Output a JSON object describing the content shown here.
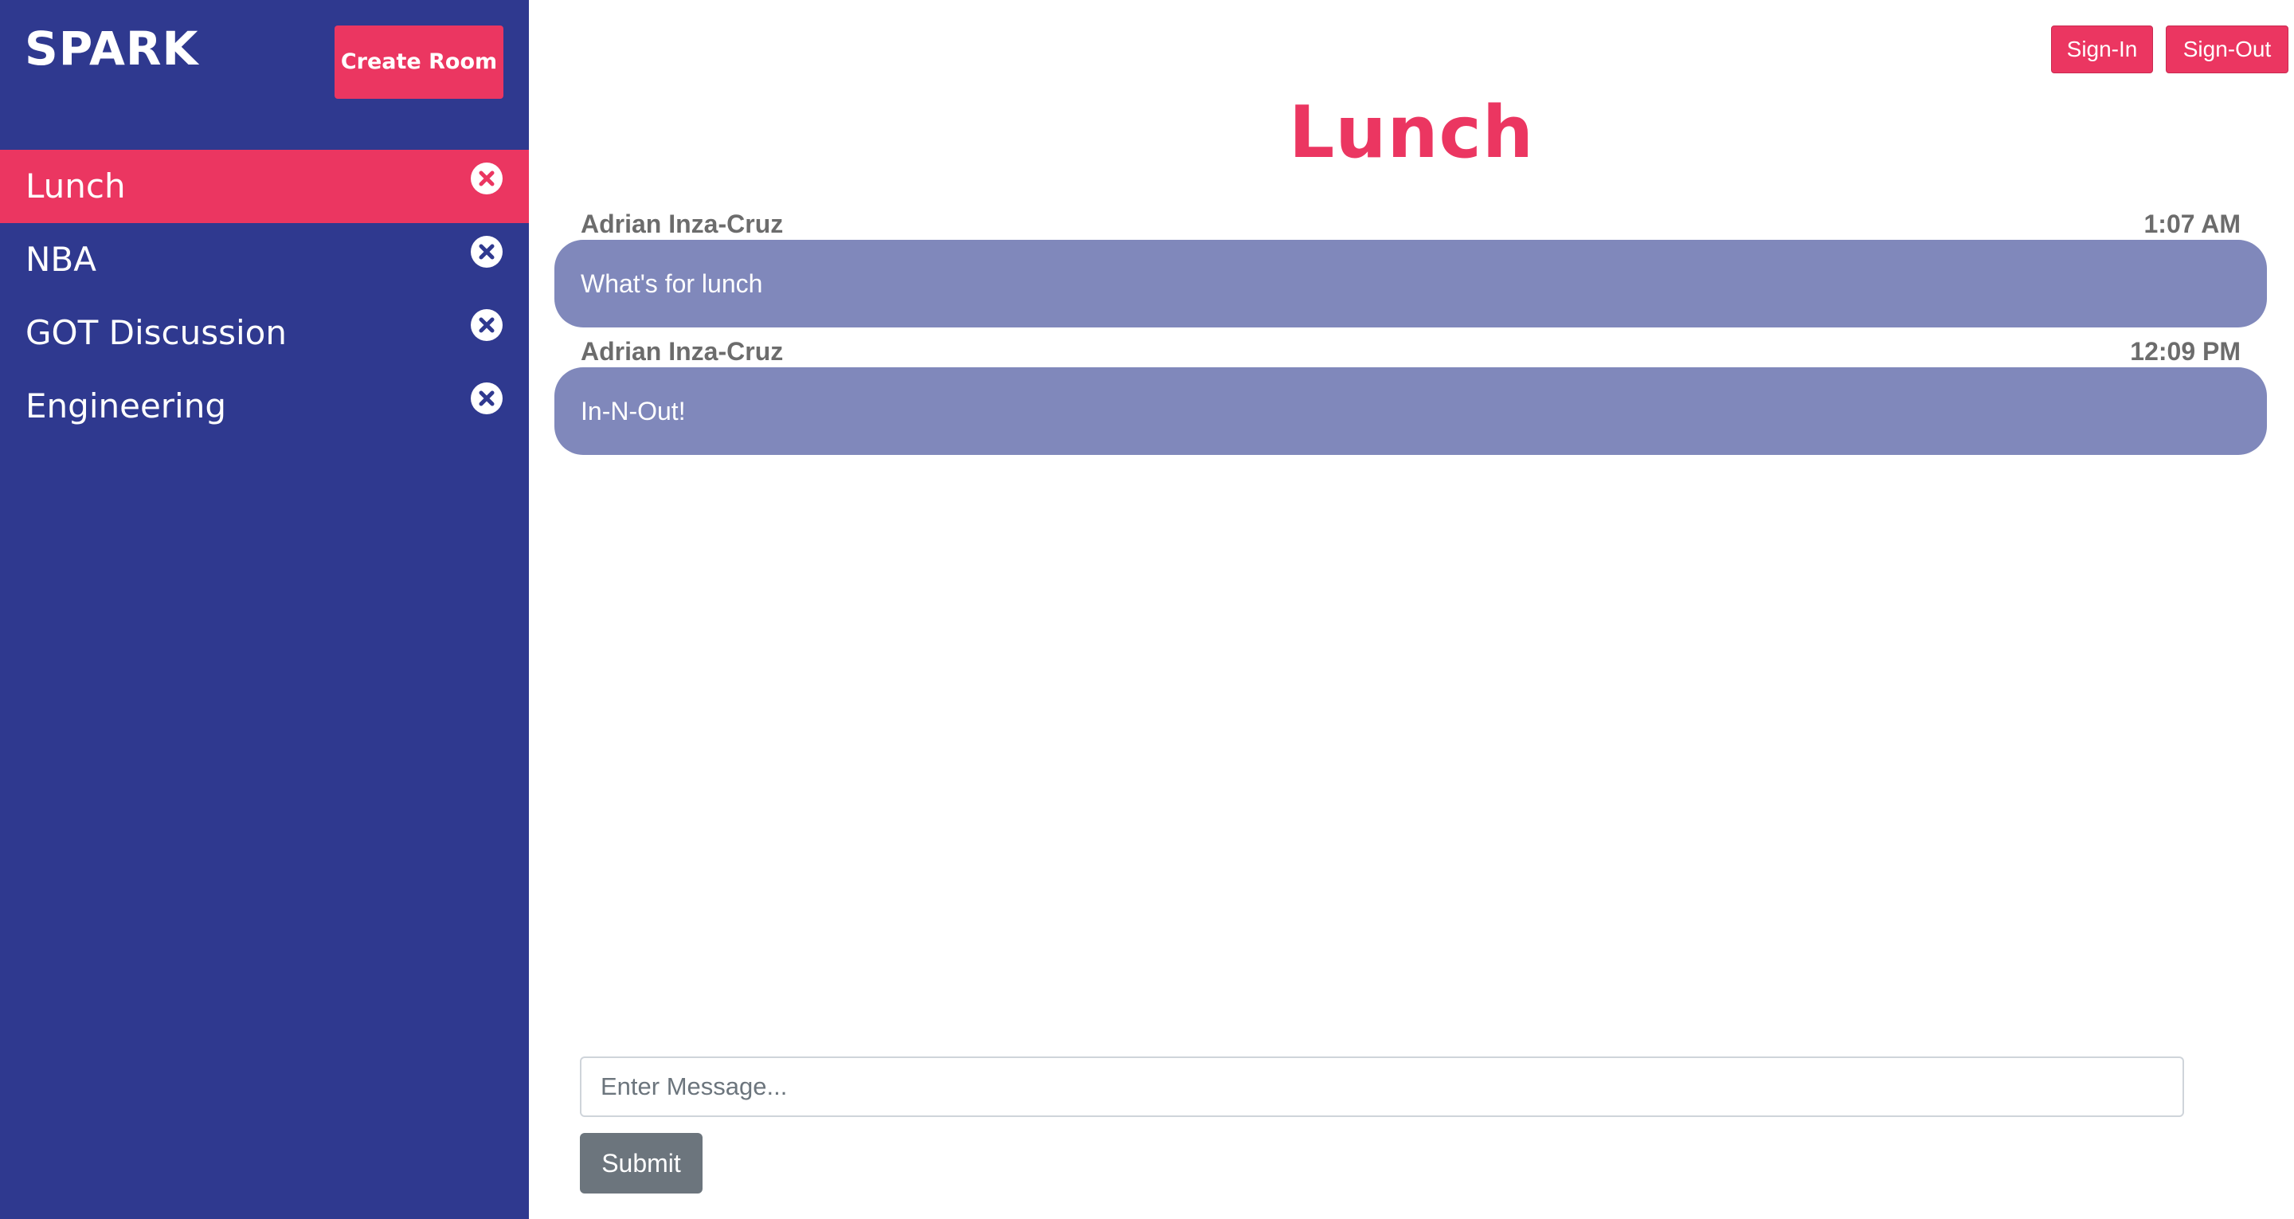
{
  "brand": "SPARK",
  "sidebar": {
    "create_room_label": "Create Room",
    "rooms": [
      {
        "label": "Lunch",
        "active": true,
        "close_icon": "close-circle-icon"
      },
      {
        "label": "NBA",
        "active": false,
        "close_icon": "close-circle-icon"
      },
      {
        "label": "GOT Discussion",
        "active": false,
        "close_icon": "close-circle-icon"
      },
      {
        "label": "Engineering",
        "active": false,
        "close_icon": "close-circle-icon"
      }
    ]
  },
  "header": {
    "sign_in_label": "Sign-In",
    "sign_out_label": "Sign-Out"
  },
  "room_title": "Lunch",
  "messages": [
    {
      "user": "Adrian Inza-Cruz",
      "time": "1:07 AM",
      "text": "What's for lunch"
    },
    {
      "user": "Adrian Inza-Cruz",
      "time": "12:09 PM",
      "text": "In-N-Out!"
    }
  ],
  "composer": {
    "placeholder": "Enter Message...",
    "value": "",
    "submit_label": "Submit"
  },
  "colors": {
    "sidebar_bg": "#2f398f",
    "accent": "#eb3661",
    "bubble": "#8088bb",
    "submit_bg": "#6c757d"
  }
}
